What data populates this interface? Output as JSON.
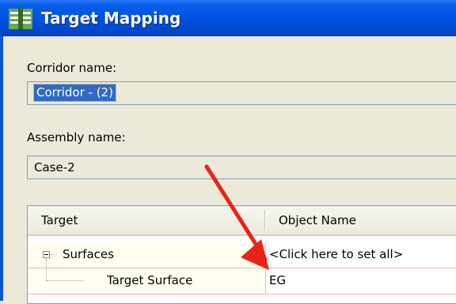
{
  "window": {
    "title": "Target Mapping"
  },
  "corridor": {
    "label": "Corridor name:",
    "value": "Corridor - (2)"
  },
  "assembly": {
    "label": "Assembly name:",
    "value": "Case-2"
  },
  "grid": {
    "columns": [
      "Target",
      "Object Name"
    ],
    "rows": [
      {
        "target": "Surfaces",
        "object": "<Click here to set all>"
      },
      {
        "target": "Target Surface",
        "object": "EG"
      }
    ]
  },
  "annotation": {
    "arrow_color": "#e8231c"
  }
}
